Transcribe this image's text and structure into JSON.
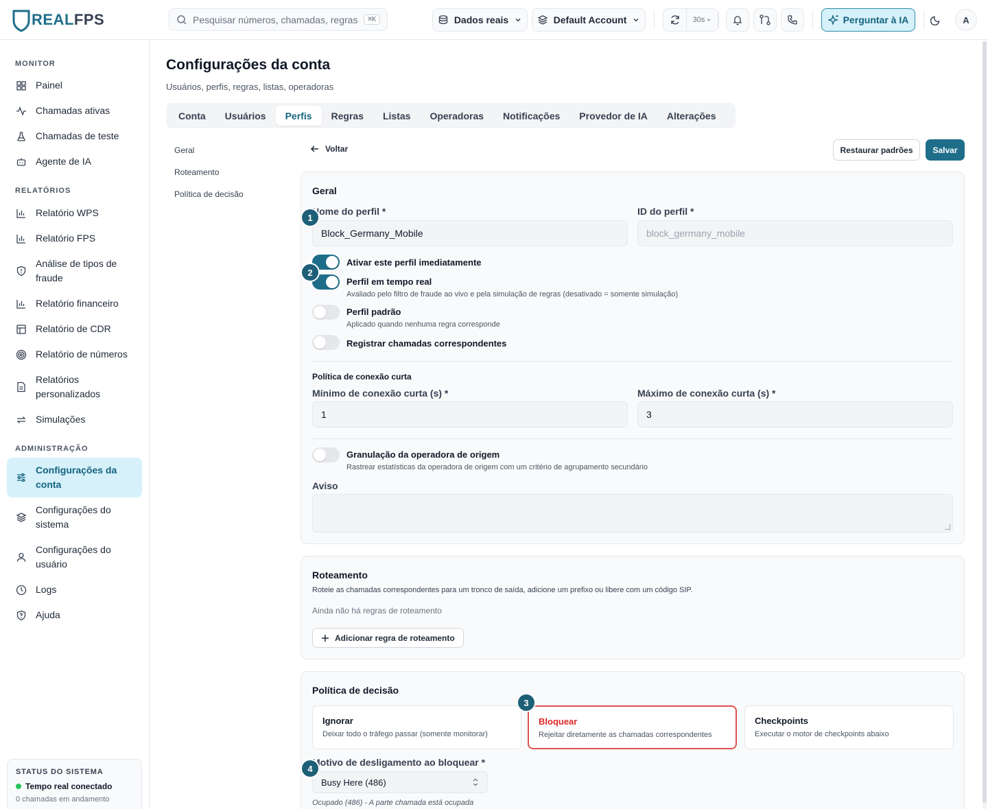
{
  "app": {
    "logo_real": "REAL",
    "logo_fps": "FPS"
  },
  "topbar": {
    "search_placeholder": "Pesquisar números, chamadas, regras...",
    "search_shortcut": "⌘K",
    "data_source": "Dados reais",
    "account": "Default Account",
    "refresh_interval": "30s",
    "ai_button": "Perguntar à IA",
    "avatar_initial": "A"
  },
  "sidebar": {
    "monitor_label": "MONITOR",
    "monitor_items": [
      "Painel",
      "Chamadas ativas",
      "Chamadas de teste",
      "Agente de IA"
    ],
    "reports_label": "RELATÓRIOS",
    "reports_items": [
      "Relatório WPS",
      "Relatório FPS",
      "Análise de tipos de fraude",
      "Relatório financeiro",
      "Relatório de CDR",
      "Relatório de números",
      "Relatórios personalizados",
      "Simulações"
    ],
    "admin_label": "ADMINISTRAÇÃO",
    "admin_items": [
      "Configurações da conta",
      "Configurações do sistema",
      "Configurações do usuário",
      "Logs",
      "Ajuda"
    ],
    "status_title": "STATUS DO SISTEMA",
    "status_live": "Tempo real conectado",
    "status_sub": "0 chamadas em andamento"
  },
  "page": {
    "title": "Configurações da conta",
    "subtitle": "Usuários, perfis, regras, listas, operadoras",
    "tabs": [
      "Conta",
      "Usuários",
      "Perfis",
      "Regras",
      "Listas",
      "Operadoras",
      "Notificações",
      "Provedor de IA",
      "Alterações"
    ],
    "active_tab": "Perfis",
    "subnav": [
      "Geral",
      "Roteamento",
      "Política de decisão"
    ],
    "back": "Voltar",
    "restore": "Restaurar padrões",
    "save": "Salvar"
  },
  "general": {
    "title": "Geral",
    "profile_name_label": "Nome do perfil *",
    "profile_name_value": "Block_Germany_Mobile",
    "profile_id_label": "ID do perfil *",
    "profile_id_value": "block_germany_mobile",
    "toggles": [
      {
        "label": "Ativar este perfil imediatamente",
        "desc": "",
        "on": true
      },
      {
        "label": "Perfil em tempo real",
        "desc": "Avaliado pelo filtro de fraude ao vivo e pela simulação de regras (desativado = somente simulação)",
        "on": true
      },
      {
        "label": "Perfil padrão",
        "desc": "Aplicado quando nenhuma regra corresponde",
        "on": false
      },
      {
        "label": "Registrar chamadas correspondentes",
        "desc": "",
        "on": false
      }
    ],
    "short_conn_title": "Política de conexão curta",
    "short_min_label": "Mínimo de conexão curta (s) *",
    "short_min_value": "1",
    "short_max_label": "Máximo de conexão curta (s) *",
    "short_max_value": "3",
    "granulation_label": "Granulação da operadora de origem",
    "granulation_desc": "Rastrear estatísticas da operadora de origem com um critério de agrupamento secundário",
    "granulation_on": false,
    "notice_label": "Aviso",
    "notice_value": ""
  },
  "routing": {
    "title": "Roteamento",
    "desc": "Roteie as chamadas correspondentes para um tronco de saída, adicione um prefixo ou libere com um código SIP.",
    "empty": "Ainda não há regras de roteamento",
    "add_button": "Adicionar regra de roteamento"
  },
  "decision": {
    "title": "Política de decisão",
    "options": [
      {
        "title": "Ignorar",
        "desc": "Deixar todo o tráfego passar (somente monitorar)",
        "selected": false
      },
      {
        "title": "Bloquear",
        "desc": "Rejeitar diretamente as chamadas correspondentes",
        "selected": true
      },
      {
        "title": "Checkpoints",
        "desc": "Executar o motor de checkpoints abaixo",
        "selected": false
      }
    ],
    "reason_label": "Motivo de desligamento ao bloquear *",
    "reason_value": "Busy Here (486)",
    "reason_hint": "Ocupado (486) - A parte chamada está ocupada"
  },
  "badges": [
    "1",
    "2",
    "3",
    "4"
  ],
  "colors": {
    "accent": "#1e6e8a",
    "accent_light": "#d6f1fa",
    "danger": "#dc2626",
    "badge": "#1e5f78"
  }
}
